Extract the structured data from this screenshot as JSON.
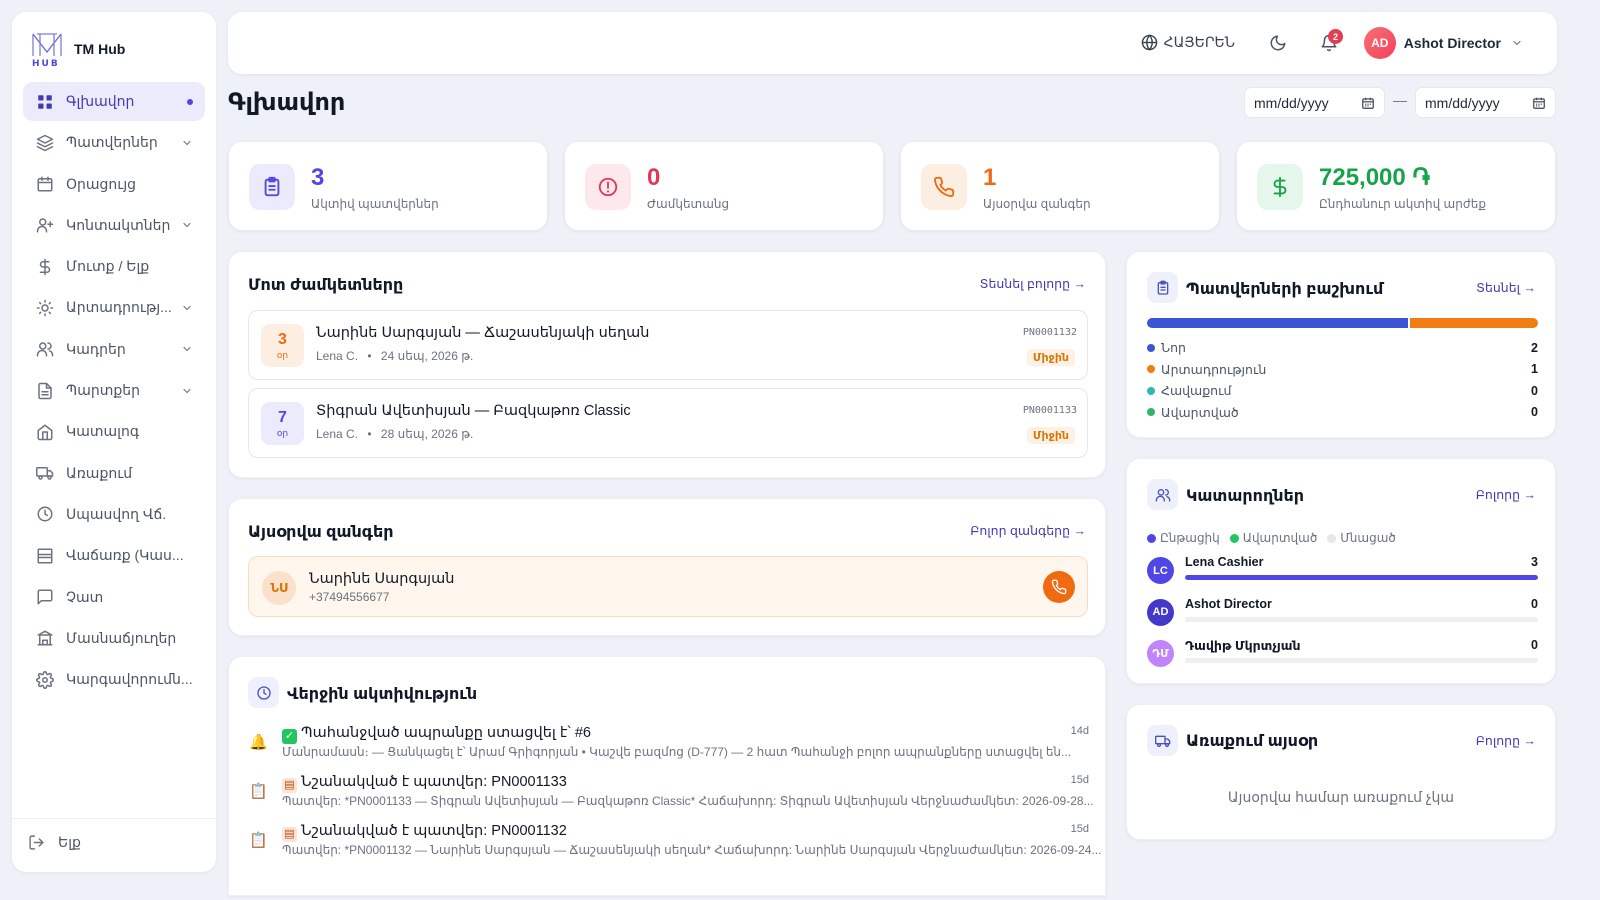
{
  "brand": {
    "name": "TM Hub",
    "logo_text": "HUB"
  },
  "sidebar": {
    "items": [
      {
        "label": "Գլխավոր",
        "icon": "grid-icon",
        "active": true
      },
      {
        "label": "Պատվերներ",
        "icon": "layers-icon",
        "expandable": true
      },
      {
        "label": "Օրացույց",
        "icon": "calendar-icon"
      },
      {
        "label": "Կոնտակտներ",
        "icon": "user-plus-icon",
        "expandable": true
      },
      {
        "label": "Մուտք / Ելք",
        "icon": "dollar-icon"
      },
      {
        "label": "Արտադրությ...",
        "icon": "sun-icon",
        "expandable": true
      },
      {
        "label": "Կադրեր",
        "icon": "users-icon",
        "expandable": true
      },
      {
        "label": "Պարտքեր",
        "icon": "file-icon",
        "expandable": true
      },
      {
        "label": "Կատալոգ",
        "icon": "home-icon"
      },
      {
        "label": "Առաքում",
        "icon": "truck-icon"
      },
      {
        "label": "Սպասվող Վճ.",
        "icon": "clock-icon"
      },
      {
        "label": "Վաճառք (Կաս...",
        "icon": "server-icon"
      },
      {
        "label": "Չատ",
        "icon": "chat-icon"
      },
      {
        "label": "Մասնաճյուղեր",
        "icon": "bank-icon"
      },
      {
        "label": "Կարգավորումն...",
        "icon": "gear-icon"
      }
    ],
    "logout_label": "Ելք"
  },
  "topbar": {
    "language": "ՀԱՅԵՐԵՆ",
    "notifications_count": "2",
    "user_initials": "AD",
    "user_name": "Ashot Director"
  },
  "page": {
    "title": "Գլխավոր",
    "date_from_placeholder": "mm/dd/yyyy",
    "date_to_placeholder": "mm/dd/yyyy",
    "date_separator": "—"
  },
  "stats": [
    {
      "value": "3",
      "label": "Ակտիվ պատվերներ",
      "color": "#4f46e5",
      "bg": "#ecebfb"
    },
    {
      "value": "0",
      "label": "Ժամկետանց",
      "color": "#e2375b",
      "bg": "#fde8ec"
    },
    {
      "value": "1",
      "label": "Այսօրվա զանգեր",
      "color": "#f06a12",
      "bg": "#fdeee2"
    },
    {
      "value": "725,000 ֏",
      "label": "Ընդհանուր ակտիվ արժեք",
      "color": "#16a34a",
      "bg": "#e4f7ea"
    }
  ],
  "deadlines": {
    "title": "Մոտ ժամկետները",
    "link": "Տեսնել բոլորը →",
    "items": [
      {
        "days": "3",
        "unit": "օր",
        "title": "Նարինե Սարգսյան — Ճաշասենյակի սեղան",
        "person": "Lena C.",
        "date": "24 սեպ, 2026 թ.",
        "code": "PN0001132",
        "badge": "Միջին",
        "accent": "#f06a12",
        "accent_bg": "#fdeee2"
      },
      {
        "days": "7",
        "unit": "օր",
        "title": "Տիգրան Ավետիսյան — Բազկաթոռ Classic",
        "person": "Lena C.",
        "date": "28 սեպ, 2026 թ.",
        "code": "PN0001133",
        "badge": "Միջին",
        "accent": "#4f46e5",
        "accent_bg": "#ecebfb"
      }
    ]
  },
  "calls": {
    "title": "Այսօրվա զանգեր",
    "link": "Բոլոր զանգերը →",
    "items": [
      {
        "initials": "ՆՍ",
        "name": "Նարինե Սարգսյան",
        "phone": "+37494556677"
      }
    ]
  },
  "activity": {
    "title": "Վերջին ակտիվություն",
    "items": [
      {
        "title": "Պահանջված ապրանքը ստացվել է՝ #6",
        "desc": "Մանրամասն։ — Ցանկացել է՝ Արամ Գրիգորյան • Կաշվե բազմոց (D-777) — 2 հատ Պահանջի բոլոր ապրանքները ստացվել են...",
        "time": "14d"
      },
      {
        "title": "Նշանակված է պատվեր: PN0001133",
        "desc": "Պատվեր: *PN0001133 — Տիգրան Ավետիսյան — Բազկաթոռ Classic* Հաճախորդ: Տիգրան Ավետիսյան Վերջնաժամկետ: 2026-09-28...",
        "time": "15d"
      },
      {
        "title": "Նշանակված է պատվեր: PN0001132",
        "desc": "Պատվեր: *PN0001132 — Նարինե Սարգսյան — Ճաշասենյակի սեղան* Հաճախորդ: Նարինե Սարգսյան Վերջնաժամկետ: 2026-09-24...",
        "time": "15d"
      }
    ]
  },
  "distribution": {
    "title": "Պատվերների բաշխում",
    "link": "Տեսնել →",
    "items": [
      {
        "label": "Նոր",
        "value": 2,
        "color": "#3b54d6"
      },
      {
        "label": "Արտադրություն",
        "value": 1,
        "color": "#f07c12"
      },
      {
        "label": "Հավաքում",
        "value": 0,
        "color": "#2fb8b0"
      },
      {
        "label": "Ավարտված",
        "value": 0,
        "color": "#34b36a"
      }
    ]
  },
  "assignees": {
    "title": "Կատարողներ",
    "link": "Բոլորը →",
    "legend": [
      {
        "label": "Ընթացիկ",
        "color": "#4f46e5"
      },
      {
        "label": "Ավարտված",
        "color": "#22c55e"
      },
      {
        "label": "Մնացած",
        "color": "#e5e7eb"
      }
    ],
    "items": [
      {
        "initials": "LC",
        "name": "Lena Cashier",
        "value": 3,
        "fraction": 1.0,
        "color": "#4f46e5"
      },
      {
        "initials": "AD",
        "name": "Ashot Director",
        "value": 0,
        "fraction": 0,
        "color": "#4338ca"
      },
      {
        "initials": "ԴՄ",
        "name": "Դավիթ Մկրտչյան",
        "value": 0,
        "fraction": 0,
        "color": "#c084fc"
      }
    ]
  },
  "delivery": {
    "title": "Առաքում այսօր",
    "link": "Բոլորը →",
    "empty": "Այսօրվա համար առաքում չկա"
  }
}
